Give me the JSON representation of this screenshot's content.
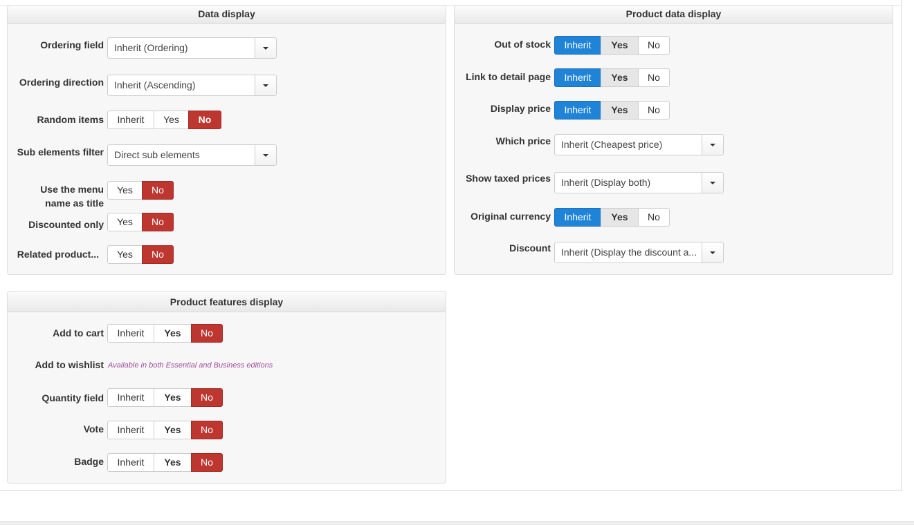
{
  "panels": {
    "data_display": {
      "title": "Data display",
      "ordering_field": {
        "label": "Ordering field",
        "value": "Inherit (Ordering)"
      },
      "ordering_direction": {
        "label": "Ordering direction",
        "value": "Inherit (Ascending)"
      },
      "random_items": {
        "label": "Random items",
        "options": [
          "Inherit",
          "Yes",
          "No"
        ],
        "selected": "No"
      },
      "sub_elements_filter": {
        "label": "Sub elements filter",
        "value": "Direct sub elements"
      },
      "menu_name_title": {
        "label_line1": "Use the menu",
        "label_line2": "name as title",
        "options": [
          "Yes",
          "No"
        ],
        "selected": "No"
      },
      "discounted_only": {
        "label": "Discounted only",
        "options": [
          "Yes",
          "No"
        ],
        "selected": "No"
      },
      "related_products": {
        "label": "Related product...",
        "options": [
          "Yes",
          "No"
        ],
        "selected": "No"
      }
    },
    "product_data_display": {
      "title": "Product data display",
      "out_of_stock": {
        "label": "Out of stock",
        "options": [
          "Inherit",
          "Yes",
          "No"
        ],
        "selected": "Inherit"
      },
      "link_detail": {
        "label": "Link to detail page",
        "options": [
          "Inherit",
          "Yes",
          "No"
        ],
        "selected": "Inherit"
      },
      "display_price": {
        "label": "Display price",
        "options": [
          "Inherit",
          "Yes",
          "No"
        ],
        "selected": "Inherit"
      },
      "which_price": {
        "label": "Which price",
        "value": "Inherit (Cheapest price)"
      },
      "taxed_prices": {
        "label": "Show taxed prices",
        "value": "Inherit (Display both)"
      },
      "original_currency": {
        "label": "Original currency",
        "options": [
          "Inherit",
          "Yes",
          "No"
        ],
        "selected": "Inherit"
      },
      "discount": {
        "label": "Discount",
        "value": "Inherit (Display the discount a..."
      }
    },
    "product_features_display": {
      "title": "Product features display",
      "add_to_cart": {
        "label": "Add to cart",
        "options": [
          "Inherit",
          "Yes",
          "No"
        ],
        "selected": "No"
      },
      "add_to_wishlist": {
        "label": "Add to wishlist",
        "note": "Available in both Essential and Business editions"
      },
      "quantity_field": {
        "label": "Quantity field",
        "options": [
          "Inherit",
          "Yes",
          "No"
        ],
        "selected": "No"
      },
      "vote": {
        "label": "Vote",
        "options": [
          "Inherit",
          "Yes",
          "No"
        ],
        "selected": "No"
      },
      "badge": {
        "label": "Badge",
        "options": [
          "Inherit",
          "Yes",
          "No"
        ],
        "selected": "No"
      }
    }
  },
  "colors": {
    "active_red": "#bd362f",
    "active_blue": "#1f83d8"
  },
  "icons": {
    "select_arrow": "caret-down-icon"
  }
}
